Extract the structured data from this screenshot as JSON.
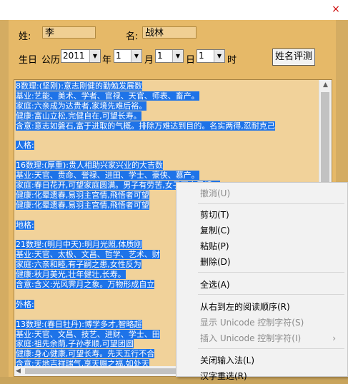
{
  "window": {
    "close_label": "×"
  },
  "form": {
    "surname_label": "姓:",
    "surname_value": "李",
    "name_label": "名:",
    "name_value": "战林",
    "birth_label": "生日",
    "calendar_label": "公历",
    "year_value": "2011",
    "year_unit": "年",
    "month_value": "1",
    "month_unit": "月",
    "day_value": "1",
    "day_unit": "日",
    "hour_value": "1",
    "hour_unit": "时",
    "evaluate_button": "姓名评测"
  },
  "textbox": {
    "lines": [
      {
        "text": "8数理:(坚刚):意志刚健的勤勉发展数",
        "selected": true
      },
      {
        "text": "基业:艺能、美术、学者、官禄、天官、师表、畜产。",
        "selected": true
      },
      {
        "text": "家庭:六亲成为达贵者,家境先难后裕。",
        "selected": true
      },
      {
        "text": "健康:富山立松,完健自在,可望长寿。",
        "selected": true
      },
      {
        "text": "含意:意志如磐石,富于进取的气概。排除万难达到目的。名实两得,忍耐克己",
        "selected": true
      },
      {
        "text": "",
        "selected": false
      },
      {
        "text": "人格:",
        "selected": true
      },
      {
        "text": "",
        "selected": false
      },
      {
        "text": "16数理:(厚重):贵人相助兴家兴业的大吉数",
        "selected": true
      },
      {
        "text": "基业:天官、贵命、誉禄、进田、学士、豪侠、慕产。",
        "selected": true
      },
      {
        "text": "家庭:春日花开,可望家庭圆满。男子有劳苦,女子不宜早婚。",
        "selected": true
      },
      {
        "text": "健康:化晕遗春,易羽主宫情,飛悟者可望",
        "selected": true
      },
      {
        "text": "健康:化晕遗春,易羽主宫情,飛悟者可望",
        "selected": true
      },
      {
        "text": "",
        "selected": false
      },
      {
        "text": "地格:",
        "selected": true
      },
      {
        "text": "",
        "selected": false
      },
      {
        "text": "21数理:(明月中天):明月光照,体质刚",
        "selected": true
      },
      {
        "text": "基业:天官、太极、文昌、哲学、艺术、财",
        "selected": true
      },
      {
        "text": "家庭:六亲和睦,有子嗣之患,女性反为",
        "selected": true
      },
      {
        "text": "健康:秋月美光,壮年健壮,长寿。",
        "selected": true
      },
      {
        "text": "含意:含义:光风霁月之象。万物形成自立",
        "selected": true
      },
      {
        "text": "",
        "selected": false
      },
      {
        "text": "外格:",
        "selected": true
      },
      {
        "text": "",
        "selected": false
      },
      {
        "text": "13数理:(春日牡丹):博学多才,智略超",
        "selected": true
      },
      {
        "text": "基业:天官、文昌、技艺、进财、学士、田",
        "selected": true
      },
      {
        "text": "家庭:祖先余荫,子孙孝顺,可望团圆",
        "selected": true
      },
      {
        "text": "健康:身心健康,可望长寿。先天五行不合",
        "selected": true
      },
      {
        "text": "含意:天地吉祥瑞气,享天赐之福,如处天",
        "selected": true
      }
    ]
  },
  "context_menu": {
    "items": [
      {
        "label": "撤消(U)",
        "disabled": true,
        "submenu": ""
      },
      {
        "label": "剪切(T)",
        "disabled": false,
        "submenu": ""
      },
      {
        "label": "复制(C)",
        "disabled": false,
        "submenu": ""
      },
      {
        "label": "粘贴(P)",
        "disabled": false,
        "submenu": ""
      },
      {
        "label": "删除(D)",
        "disabled": false,
        "submenu": ""
      },
      {
        "label": "全选(A)",
        "disabled": false,
        "submenu": ""
      },
      {
        "label": "从右到左的阅读顺序(R)",
        "disabled": false,
        "submenu": ""
      },
      {
        "label": "显示 Unicode 控制字符(S)",
        "disabled": true,
        "submenu": ""
      },
      {
        "label": "插入 Unicode 控制字符(I)",
        "disabled": true,
        "submenu": "›"
      },
      {
        "label": "关闭输入法(L)",
        "disabled": false,
        "submenu": ""
      },
      {
        "label": "汉字重选(R)",
        "disabled": false,
        "submenu": ""
      }
    ]
  },
  "icons": {
    "dropdown_arrow": "chevron-down-icon",
    "scroll_up": "scroll-up-icon",
    "scroll_left": "scroll-left-icon"
  }
}
